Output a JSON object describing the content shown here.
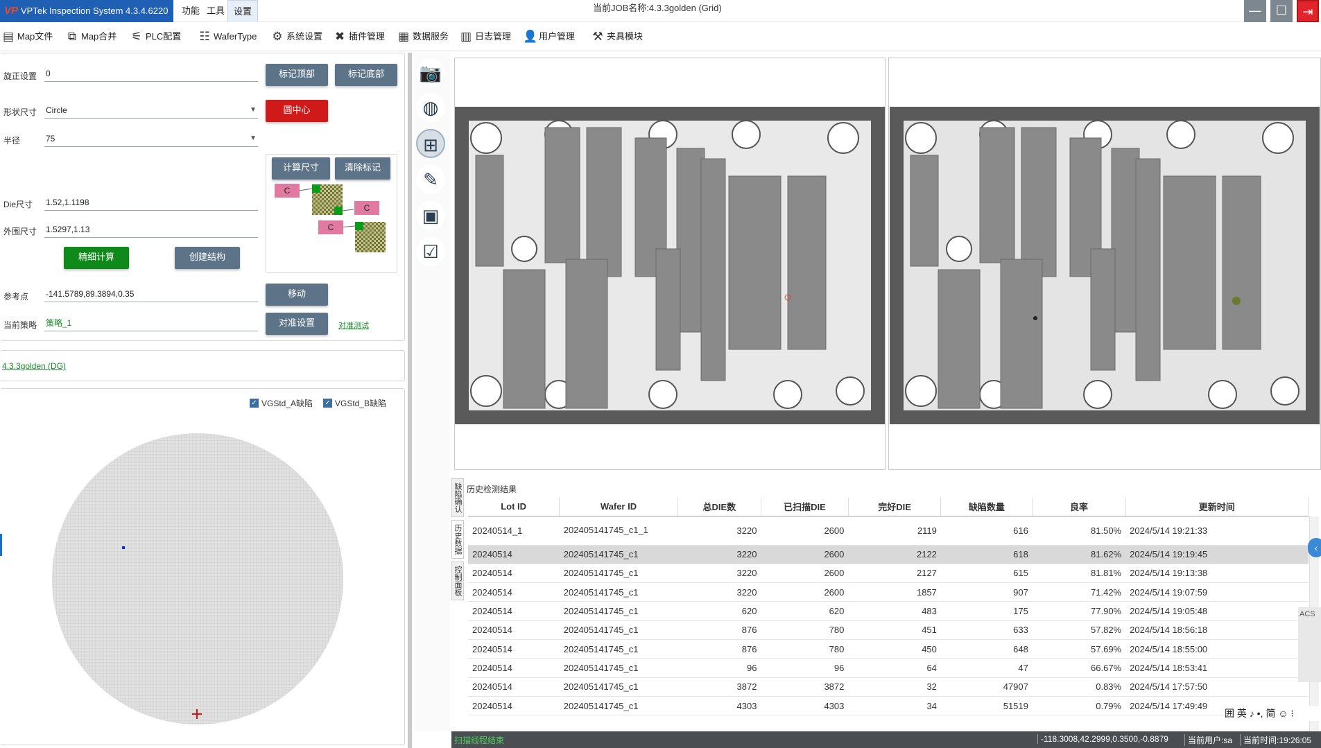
{
  "app": {
    "title": "VPTek Inspection System 4.3.4.6220",
    "logo_text": "VP"
  },
  "menus": [
    "功能",
    "工具",
    "设置"
  ],
  "job": {
    "label": "当前JOB名称:",
    "value": "4.3.3golden (Grid)"
  },
  "window_controls": {
    "minimize": "—",
    "maximize": "☐",
    "close": "⇥"
  },
  "toolbar": [
    {
      "label": "Map文件",
      "icon": "map-file-icon",
      "glyph": "▤"
    },
    {
      "label": "Map合并",
      "icon": "map-merge-icon",
      "glyph": "⧉"
    },
    {
      "label": "PLC配置",
      "icon": "plc-config-icon",
      "glyph": "⚟"
    },
    {
      "label": "WaferType",
      "icon": "wafer-type-icon",
      "glyph": "☷"
    },
    {
      "label": "系统设置",
      "icon": "gear-icon",
      "glyph": "⚙"
    },
    {
      "label": "插件管理",
      "icon": "tools-icon",
      "glyph": "✖"
    },
    {
      "label": "数据服务",
      "icon": "data-service-icon",
      "glyph": "▦"
    },
    {
      "label": "日志管理",
      "icon": "log-icon",
      "glyph": "▥"
    },
    {
      "label": "用户管理",
      "icon": "user-icon",
      "glyph": "👤"
    },
    {
      "label": "夹具模块",
      "icon": "fixture-icon",
      "glyph": "⚒"
    }
  ],
  "settings": {
    "rotation_label": "旋正设置",
    "rotation_value": "0",
    "mark_top": "标记顶部",
    "mark_bottom": "标记底部",
    "shape_label": "形状尺寸",
    "shape_value": "Circle",
    "circle_center": "圆中心",
    "radius_label": "半径",
    "radius_value": "75",
    "calc_size": "计算尺寸",
    "clear_mark": "清除标记",
    "mark_c": "C",
    "die_label": "Die尺寸",
    "die_value": "1.52,1.1198",
    "outer_label": "外围尺寸",
    "outer_value": "1.5297,1.13",
    "fine_calc": "精细计算",
    "create_struct": "创建结构",
    "ref_label": "参考点",
    "ref_value": "-141.5789,89.3894,0.35",
    "move": "移动",
    "strategy_label": "当前策略",
    "strategy_value": "策略_1",
    "align_settings": "对准设置",
    "align_test": "对准测试"
  },
  "recipe_link": "4.3.3golden (DG)",
  "wafer_options": [
    "VGStd_A缺陷",
    "VGStd_B缺陷"
  ],
  "side_tabs": [
    "缺陷确认",
    "历史数据",
    "控制面板"
  ],
  "history": {
    "title": "历史检测结果",
    "columns": [
      "Lot ID",
      "Wafer ID",
      "总DIE数",
      "已扫描DIE",
      "完好DIE",
      "缺陷数量",
      "良率",
      "更新时间"
    ],
    "rows": [
      [
        "20240514_1",
        "202405141745_c1_1",
        "3220",
        "2600",
        "2119",
        "616",
        "81.50%",
        "2024/5/14 19:21:33"
      ],
      [
        "20240514",
        "202405141745_c1",
        "3220",
        "2600",
        "2122",
        "618",
        "81.62%",
        "2024/5/14 19:19:45"
      ],
      [
        "20240514",
        "202405141745_c1",
        "3220",
        "2600",
        "2127",
        "615",
        "81.81%",
        "2024/5/14 19:13:38"
      ],
      [
        "20240514",
        "202405141745_c1",
        "3220",
        "2600",
        "1857",
        "907",
        "71.42%",
        "2024/5/14 19:07:59"
      ],
      [
        "20240514",
        "202405141745_c1",
        "620",
        "620",
        "483",
        "175",
        "77.90%",
        "2024/5/14 19:05:48"
      ],
      [
        "20240514",
        "202405141745_c1",
        "876",
        "780",
        "451",
        "633",
        "57.82%",
        "2024/5/14 18:56:18"
      ],
      [
        "20240514",
        "202405141745_c1",
        "876",
        "780",
        "450",
        "648",
        "57.69%",
        "2024/5/14 18:55:00"
      ],
      [
        "20240514",
        "202405141745_c1",
        "96",
        "96",
        "64",
        "47",
        "66.67%",
        "2024/5/14 18:53:41"
      ],
      [
        "20240514",
        "202405141745_c1",
        "3872",
        "3872",
        "32",
        "47907",
        "0.83%",
        "2024/5/14 17:57:50"
      ],
      [
        "20240514",
        "202405141745_c1",
        "4303",
        "4303",
        "34",
        "51519",
        "0.79%",
        "2024/5/14 17:49:49"
      ]
    ]
  },
  "ime": "囲 英 ♪ •, 简 ☺ ⁝",
  "acs_label": "ACS",
  "status": {
    "left": "扫描线程结束",
    "coords": "-118.3008,42.2999,0.3500,-0.8879",
    "user_label": "当前用户:",
    "user": "sa",
    "time_label": "当前时间:",
    "time": "19:26:05"
  }
}
